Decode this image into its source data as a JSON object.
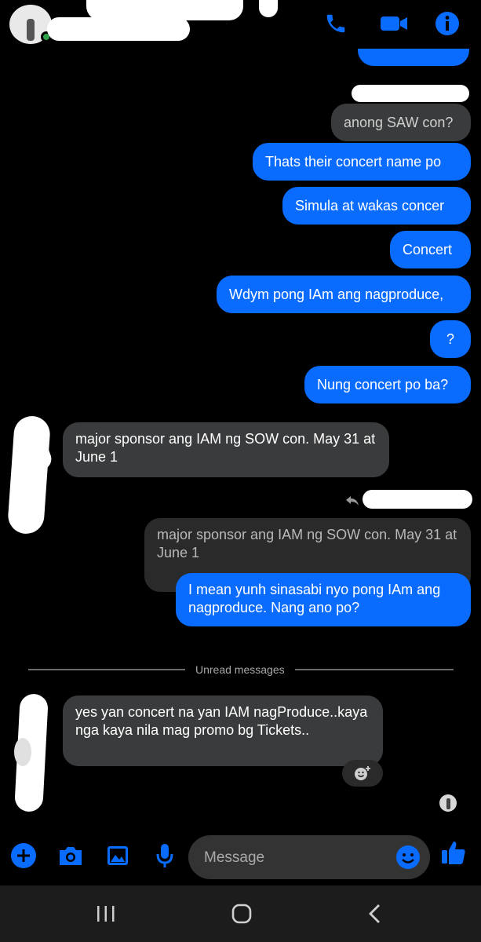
{
  "colors": {
    "accent": "#0a6cff",
    "incoming": "#3a3b3c",
    "background": "#000000"
  },
  "header": {
    "icons": [
      "phone-icon",
      "video-call-icon",
      "info-icon"
    ]
  },
  "messages": {
    "m1": "anong SAW con?",
    "m2": "Thats their concert name po",
    "m3": "Simula at wakas concer",
    "m4": "Concert",
    "m5": "Wdym pong IAm ang nagproduce,",
    "m6": "?",
    "m7": "Nung concert po ba?",
    "m8": "major sponsor ang IAM ng SOW con. May 31 at June 1",
    "m9_quote": "major sponsor ang IAM ng SOW con. May 31 at June 1",
    "m9": "I mean yunh sinasabi nyo pong IAm ang nagproduce. Nang ano po?",
    "m10": "yes yan concert na yan IAM nagProduce..kaya nga kaya nila mag promo bg Tickets.."
  },
  "unread_label": "Unread messages",
  "composer": {
    "placeholder": "Message",
    "icons": [
      "plus-icon",
      "camera-icon",
      "gallery-icon",
      "microphone-icon",
      "emoji-icon",
      "thumbs-up-icon"
    ]
  },
  "navbar": {
    "icons": [
      "recent-apps-icon",
      "home-icon",
      "back-icon"
    ]
  }
}
